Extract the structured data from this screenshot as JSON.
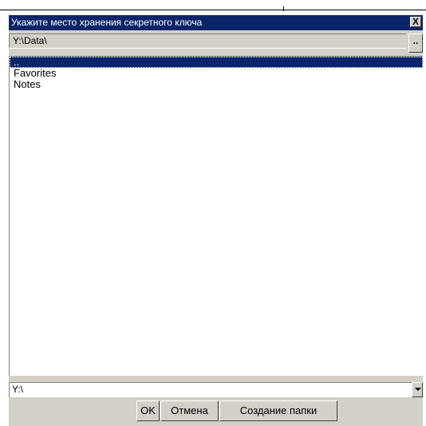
{
  "dialog": {
    "title": "Укажите место хранения секретного ключа",
    "close_glyph": "X",
    "current_path": "Y:\\Data\\",
    "browse_label": ".."
  },
  "file_list": {
    "items": [
      {
        "label": "..",
        "selected": true
      },
      {
        "label": "Favorites",
        "selected": false
      },
      {
        "label": "Notes",
        "selected": false
      }
    ]
  },
  "drive_select": {
    "value": "Y:\\"
  },
  "buttons": {
    "ok": "OK",
    "cancel": "Отмена",
    "create_folder": "Создание папки"
  },
  "colors": {
    "titlebar": "#0a246a",
    "selection": "#0a246a",
    "face": "#d4d0c8"
  }
}
